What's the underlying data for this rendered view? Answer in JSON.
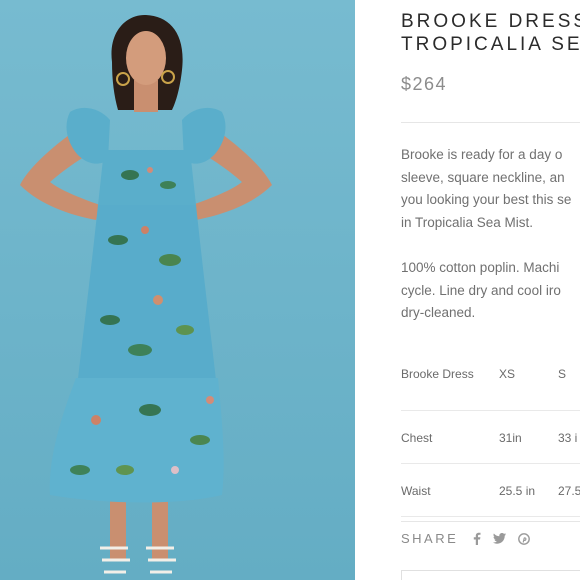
{
  "product": {
    "title_line1": "BROOKE DRESS",
    "title_line2": "TROPICALIA SEA",
    "price": "$264",
    "description": [
      "Brooke is ready for a day o",
      "sleeve, square neckline, an",
      "you looking your best this se",
      "in Tropicalia Sea Mist."
    ],
    "care": [
      "100% cotton poplin. Machi",
      "cycle. Line dry and cool iro",
      "dry-cleaned."
    ]
  },
  "size_table": {
    "header": [
      "Brooke Dress",
      "XS",
      "S"
    ],
    "rows": [
      {
        "label": "Chest",
        "values": [
          "31in",
          "33 i"
        ]
      },
      {
        "label": "Waist",
        "values": [
          "25.5 in",
          "27.5"
        ]
      }
    ]
  },
  "share": {
    "label": "SHARE",
    "icons": [
      "facebook-icon",
      "twitter-icon",
      "pinterest-icon"
    ]
  },
  "colors": {
    "photo_background": "#6fb6cc",
    "dress": "#5aaecb",
    "title_text": "#2b2b2b",
    "price_text": "#8c8c8c"
  }
}
